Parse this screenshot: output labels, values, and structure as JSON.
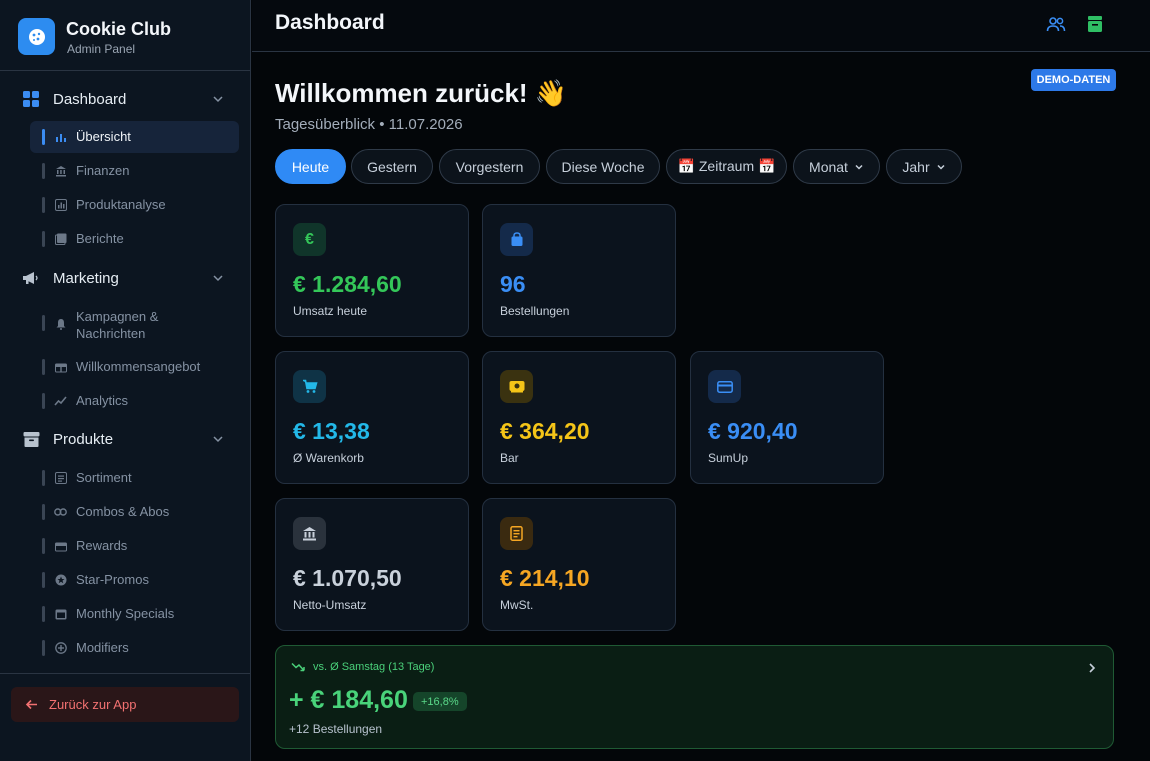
{
  "brand": {
    "title": "Cookie Club",
    "subtitle": "Admin Panel"
  },
  "sidebar": {
    "groups": [
      {
        "label": "Dashboard",
        "icon": "grid-icon",
        "items": [
          {
            "label": "Übersicht",
            "icon": "bar-chart-icon",
            "active": true
          },
          {
            "label": "Finanzen",
            "icon": "bank-icon"
          },
          {
            "label": "Produktanalyse",
            "icon": "analytics-icon"
          },
          {
            "label": "Berichte",
            "icon": "report-icon"
          }
        ]
      },
      {
        "label": "Marketing",
        "icon": "megaphone-icon",
        "items": [
          {
            "label": "Kampagnen & Nachrichten",
            "icon": "bell-icon"
          },
          {
            "label": "Willkommensangebot",
            "icon": "gift-icon"
          },
          {
            "label": "Analytics",
            "icon": "trend-icon"
          }
        ]
      },
      {
        "label": "Produkte",
        "icon": "archive-icon",
        "items": [
          {
            "label": "Sortiment",
            "icon": "list-icon"
          },
          {
            "label": "Combos & Abos",
            "icon": "link-icon"
          },
          {
            "label": "Rewards",
            "icon": "gift-box-icon"
          },
          {
            "label": "Star-Promos",
            "icon": "star-icon"
          },
          {
            "label": "Monthly Specials",
            "icon": "calendar-icon"
          },
          {
            "label": "Modifiers",
            "icon": "plus-circle-icon"
          }
        ]
      }
    ],
    "back_label": "Zurück zur App"
  },
  "topbar": {
    "title": "Dashboard"
  },
  "main": {
    "demo_badge": "DEMO-DATEN",
    "welcome": "Willkommen zurück! 👋",
    "subline": "Tagesüberblick • 11.07.2026",
    "filters": {
      "today": "Heute",
      "yesterday": "Gestern",
      "day_before": "Vorgestern",
      "this_week": "Diese Woche",
      "range": "📅 Zeitraum 📅",
      "month": "Monat",
      "year": "Jahr"
    },
    "cards": {
      "revenue": {
        "value": "€ 1.284,60",
        "label": "Umsatz heute",
        "color": "#34c759"
      },
      "orders": {
        "value": "96",
        "label": "Bestellungen",
        "color": "#3a8ef5"
      },
      "cart": {
        "value": "€ 13,38",
        "label": "Ø Warenkorb",
        "color": "#23b8e8"
      },
      "cash": {
        "value": "€ 364,20",
        "label": "Bar",
        "color": "#f5c518"
      },
      "sumup": {
        "value": "€ 920,40",
        "label": "SumUp",
        "color": "#3a8ef5"
      },
      "net": {
        "value": "€ 1.070,50",
        "label": "Netto-Umsatz",
        "color": "#c9d1db"
      },
      "vat": {
        "value": "€ 214,10",
        "label": "MwSt.",
        "color": "#f5a623"
      }
    },
    "compare": {
      "label": "vs. Ø Samstag (13 Tage)",
      "value": "+ € 184,60",
      "badge": "+16,8%",
      "sub": "+12 Bestellungen"
    }
  }
}
